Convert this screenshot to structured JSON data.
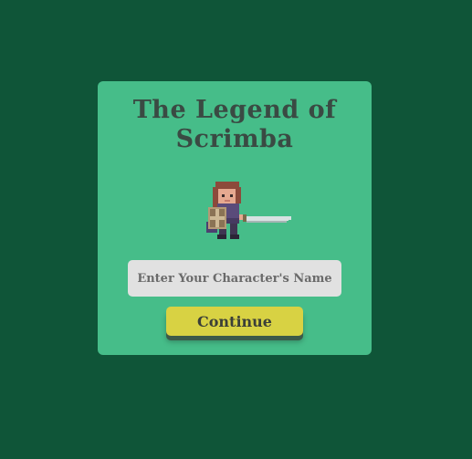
{
  "game": {
    "title": "The Legend of Scrimba",
    "hero_icon": "knight-with-sword-and-shield-sprite"
  },
  "form": {
    "name_placeholder": "Enter Your Character's Name",
    "name_value": "",
    "continue_label": "Continue"
  },
  "colors": {
    "background": "#0f5538",
    "card": "#46bd89",
    "title": "#3a4a43",
    "input_bg": "#e1e1e1",
    "button": "#d8d243"
  }
}
